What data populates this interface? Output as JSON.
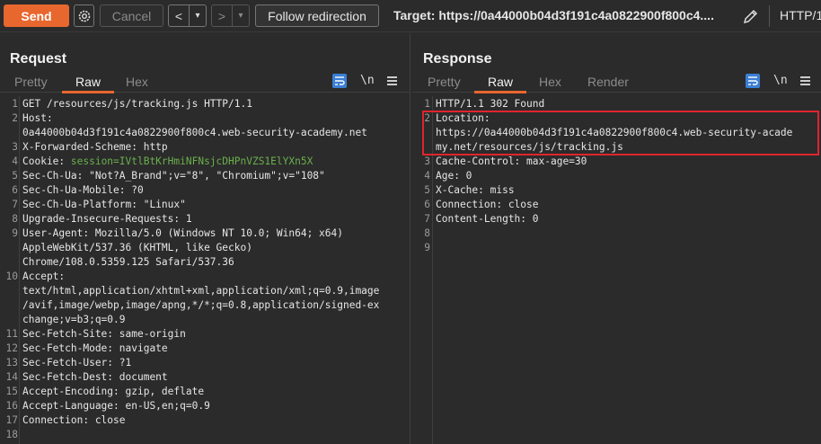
{
  "toolbar": {
    "send_label": "Send",
    "cancel_label": "Cancel",
    "follow_label": "Follow redirection",
    "back_glyph": "<",
    "forward_glyph": ">",
    "dropdown_glyph": "▾",
    "target_label": "Target:",
    "target_url": "https://0a44000b04d3f191c4a0822900f800c4....",
    "http_version": "HTTP/1"
  },
  "request": {
    "title": "Request",
    "tabs": [
      "Pretty",
      "Raw",
      "Hex"
    ],
    "active_tab": "Raw",
    "newline_toggle": "\\n",
    "lines": [
      {
        "n": "1",
        "text": "GET /resources/js/tracking.js HTTP/1.1"
      },
      {
        "n": "2",
        "text": "Host:"
      },
      {
        "n": "",
        "text": "0a44000b04d3f191c4a0822900f800c4.web-security-academy.net"
      },
      {
        "n": "3",
        "text": "X-Forwarded-Scheme: http"
      },
      {
        "n": "4",
        "name": "Cookie: ",
        "value": "session=IVtlBtKrHmiNFNsjcDHPnVZS1ElYXn5X"
      },
      {
        "n": "5",
        "text": "Sec-Ch-Ua: \"Not?A_Brand\";v=\"8\", \"Chromium\";v=\"108\""
      },
      {
        "n": "6",
        "text": "Sec-Ch-Ua-Mobile: ?0"
      },
      {
        "n": "7",
        "text": "Sec-Ch-Ua-Platform: \"Linux\""
      },
      {
        "n": "8",
        "text": "Upgrade-Insecure-Requests: 1"
      },
      {
        "n": "9",
        "text": "User-Agent: Mozilla/5.0 (Windows NT 10.0; Win64; x64)"
      },
      {
        "n": "",
        "text": "AppleWebKit/537.36 (KHTML, like Gecko)"
      },
      {
        "n": "",
        "text": "Chrome/108.0.5359.125 Safari/537.36"
      },
      {
        "n": "10",
        "text": "Accept:"
      },
      {
        "n": "",
        "text": "text/html,application/xhtml+xml,application/xml;q=0.9,image"
      },
      {
        "n": "",
        "text": "/avif,image/webp,image/apng,*/*;q=0.8,application/signed-ex"
      },
      {
        "n": "",
        "text": "change;v=b3;q=0.9"
      },
      {
        "n": "11",
        "text": "Sec-Fetch-Site: same-origin"
      },
      {
        "n": "12",
        "text": "Sec-Fetch-Mode: navigate"
      },
      {
        "n": "13",
        "text": "Sec-Fetch-User: ?1"
      },
      {
        "n": "14",
        "text": "Sec-Fetch-Dest: document"
      },
      {
        "n": "15",
        "text": "Accept-Encoding: gzip, deflate"
      },
      {
        "n": "16",
        "text": "Accept-Language: en-US,en;q=0.9"
      },
      {
        "n": "17",
        "text": "Connection: close"
      },
      {
        "n": "18",
        "text": ""
      }
    ]
  },
  "response": {
    "title": "Response",
    "tabs": [
      "Pretty",
      "Raw",
      "Hex",
      "Render"
    ],
    "active_tab": "Raw",
    "newline_toggle": "\\n",
    "lines": [
      {
        "n": "1",
        "text": "HTTP/1.1 302 Found"
      },
      {
        "n": "2",
        "text": "Location:"
      },
      {
        "n": "",
        "text": "https://0a44000b04d3f191c4a0822900f800c4.web-security-acade"
      },
      {
        "n": "",
        "text": "my.net/resources/js/tracking.js"
      },
      {
        "n": "3",
        "text": "Cache-Control: max-age=30"
      },
      {
        "n": "4",
        "text": "Age: 0"
      },
      {
        "n": "5",
        "text": "X-Cache: miss"
      },
      {
        "n": "6",
        "text": "Connection: close"
      },
      {
        "n": "7",
        "text": "Content-Length: 0"
      },
      {
        "n": "8",
        "text": ""
      },
      {
        "n": "9",
        "text": ""
      }
    ]
  },
  "colors": {
    "accent": "#e8672f",
    "highlight_box": "#e0242e",
    "toggle_blue": "#3b7fd4",
    "cookie_value": "#6ab04c"
  }
}
